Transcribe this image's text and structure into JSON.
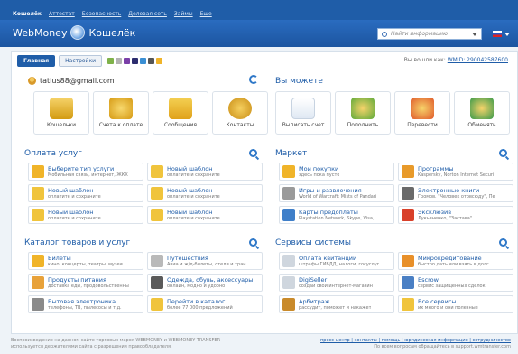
{
  "topbar": {
    "links": [
      "Кошелёк",
      "Аттестат",
      "Безопасность",
      "Деловая сеть",
      "Займы",
      "Еще"
    ]
  },
  "header": {
    "brand": "WebMoney",
    "product": "Кошелёк",
    "search_placeholder": "Найти информацию"
  },
  "tabs": {
    "main": "Главная",
    "settings": "Настройки"
  },
  "wmid": {
    "label": "Вы вошли как:",
    "value": "WMID: 290042587600"
  },
  "account": {
    "email": "tatius88@gmail.com"
  },
  "quick": {
    "title": "Вы можете",
    "left_tiles": [
      "Кошельки",
      "Счета к оплате",
      "Сообщения",
      "Контакты"
    ],
    "right_tiles": [
      "Выписать счет",
      "Пополнить",
      "Перевести",
      "Обменять"
    ]
  },
  "payments": {
    "title": "Оплата услуг",
    "items": [
      {
        "title": "Выберите тип услуги",
        "sub": "Мобильная связь, интернет, ЖКХ"
      },
      {
        "title": "Новый шаблон",
        "sub": "оплатите и сохраните"
      },
      {
        "title": "Новый шаблон",
        "sub": "оплатите и сохраните"
      },
      {
        "title": "Новый шаблон",
        "sub": "оплатите и сохраните"
      },
      {
        "title": "Новый шаблон",
        "sub": "оплатите и сохраните"
      },
      {
        "title": "Новый шаблон",
        "sub": "оплатите и сохраните"
      }
    ]
  },
  "market": {
    "title": "Маркет",
    "items": [
      {
        "title": "Мои покупки",
        "sub": "здесь пока пусто"
      },
      {
        "title": "Программы",
        "sub": "Kaspersky, Norton Internet Securi"
      },
      {
        "title": "Игры и развлечения",
        "sub": "World of Warcraft: Mists of Pandari"
      },
      {
        "title": "Электронные книги",
        "sub": "Громов. \"Человек отовсюду\", Пе"
      },
      {
        "title": "Карты предоплаты",
        "sub": "Playstation Network, Skype, Visa,"
      },
      {
        "title": "Эксклюзив",
        "sub": "Лукьяненко, \"Застава\""
      }
    ]
  },
  "catalog": {
    "title": "Каталог товаров и услуг",
    "items": [
      {
        "title": "Билеты",
        "sub": "кино, концерты, театры, музеи"
      },
      {
        "title": "Путешествия",
        "sub": "Авиа и ж/д-билеты, отели и тран"
      },
      {
        "title": "Продукты питания",
        "sub": "доставка еды, продовольственны"
      },
      {
        "title": "Одежда, обувь, аксессуары",
        "sub": "онлайн, модно и удобно"
      },
      {
        "title": "Бытовая электроника",
        "sub": "телефоны, ТВ, пылесосы и т.д."
      },
      {
        "title": "Перейти в каталог",
        "sub": "более 77 000 предложений"
      }
    ]
  },
  "services": {
    "title": "Сервисы системы",
    "items": [
      {
        "title": "Оплата квитанций",
        "sub": "штрафы ГИБДД, налоги, госуслуг"
      },
      {
        "title": "Микрокредитование",
        "sub": "быстро дать или взять в долг"
      },
      {
        "title": "DigiSeller",
        "sub": "создай свой интернет-магазин"
      },
      {
        "title": "Escrow",
        "sub": "сервис защищенных сделок"
      },
      {
        "title": "Арбитраж",
        "sub": "рассудит, поможет и накажет"
      },
      {
        "title": "Все сервисы",
        "sub": "их много и они полезные"
      }
    ]
  },
  "footer": {
    "left_line1": "Воспроизведение на данном сайте торговых марок WEBMONEY и WEBMONEY TRANSFER",
    "left_line2": "используется держателями сайта с разрешения правообладателя.",
    "right_links": "пресс-центр | контакты | помощь | юридическая информация | сотрудничество",
    "right_line2": "По всем вопросам обращайтесь в support.wmtransfer.com"
  }
}
